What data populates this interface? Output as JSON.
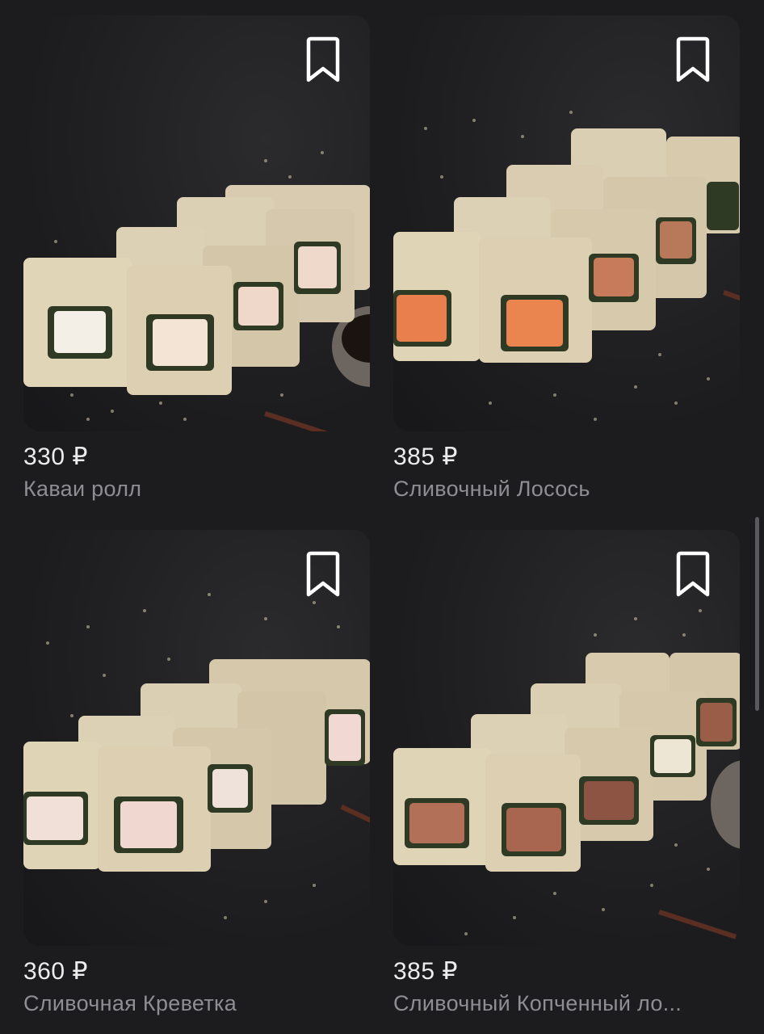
{
  "products": [
    {
      "price": "330 ₽",
      "name": "Каваи ролл",
      "bookmark_icon": "bookmark-icon"
    },
    {
      "price": "385 ₽",
      "name": "Сливочный Лосось",
      "bookmark_icon": "bookmark-icon"
    },
    {
      "price": "360 ₽",
      "name": "Сливочная Креветка",
      "bookmark_icon": "bookmark-icon"
    },
    {
      "price": "385 ₽",
      "name": "Сливочный Копченный ло...",
      "bookmark_icon": "bookmark-icon"
    }
  ],
  "colors": {
    "background": "#1c1c1e",
    "price_text": "#ececec",
    "name_text": "#8e8e93",
    "bookmark_stroke": "#ffffff"
  }
}
